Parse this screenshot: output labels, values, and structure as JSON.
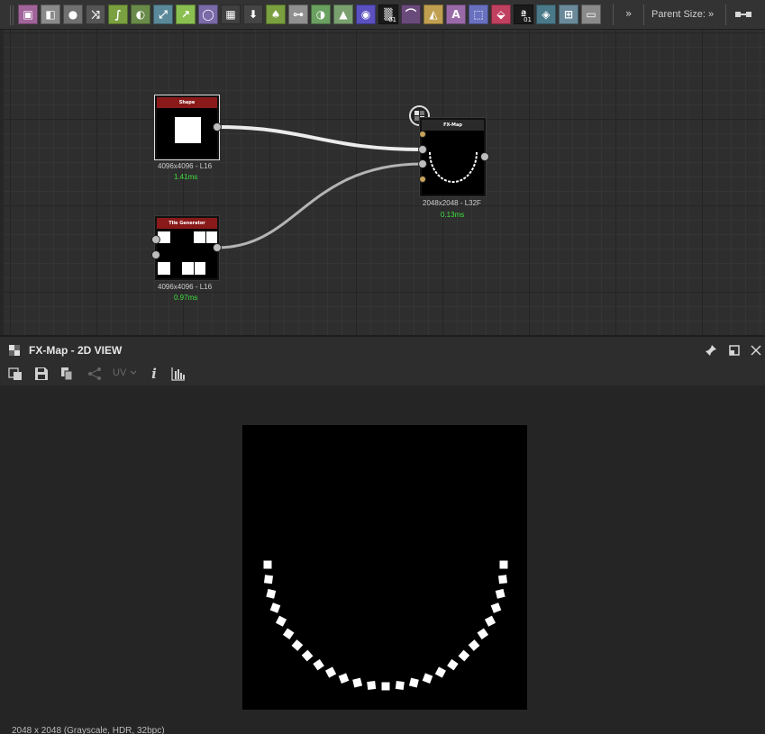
{
  "toolbar": {
    "icons": [
      {
        "name": "bitmap-icon",
        "color": "#a0649a",
        "glyph": "▣"
      },
      {
        "name": "svg-icon",
        "color": "#8a8a8a",
        "glyph": "◧"
      },
      {
        "name": "uniform-color-icon",
        "color": "#707070",
        "glyph": "●"
      },
      {
        "name": "random-icon",
        "color": "#555555",
        "glyph": "⤨"
      },
      {
        "name": "curve-icon",
        "color": "#7aa040",
        "glyph": "∫"
      },
      {
        "name": "gradient-map-icon",
        "color": "#6a8a4a",
        "glyph": "◐"
      },
      {
        "name": "transform-icon",
        "color": "#5a8a9a",
        "glyph": "⤢"
      },
      {
        "name": "directional-warp-icon",
        "color": "#8ac050",
        "glyph": "↗"
      },
      {
        "name": "shape-icon",
        "color": "#7a6aa8",
        "glyph": "◯"
      },
      {
        "name": "tile-icon",
        "color": "#404040",
        "glyph": "▦"
      },
      {
        "name": "output-icon",
        "color": "#454545",
        "glyph": "⬇"
      },
      {
        "name": "blend-icon",
        "color": "#7aa040",
        "glyph": "♠"
      },
      {
        "name": "switch-icon",
        "color": "#909090",
        "glyph": "⊶"
      },
      {
        "name": "levels-icon",
        "color": "#6aa060",
        "glyph": "◑"
      },
      {
        "name": "histogram-icon",
        "color": "#7aa070",
        "glyph": "▲"
      },
      {
        "name": "hsl-icon",
        "color": "#5a50c0",
        "glyph": "◉"
      },
      {
        "name": "noise-icon",
        "color": "#1a1a1a",
        "glyph": "▒",
        "sub": "01"
      },
      {
        "name": "warp-icon",
        "color": "#6a4a7a",
        "glyph": "⌒"
      },
      {
        "name": "sharpen-icon",
        "color": "#c0a050",
        "glyph": "◭"
      },
      {
        "name": "text-icon",
        "color": "#9a6aa8",
        "glyph": "A"
      },
      {
        "name": "crop-icon",
        "color": "#6a70c0",
        "glyph": "⬚"
      },
      {
        "name": "fill-icon",
        "color": "#c04060",
        "glyph": "⬙"
      },
      {
        "name": "pixel-processor-icon",
        "color": "#1a1a1a",
        "glyph": "ª",
        "sub": "01"
      },
      {
        "name": "distance-icon",
        "color": "#4a7a8a",
        "glyph": "◈"
      },
      {
        "name": "fxmap-icon",
        "color": "#6a8a9a",
        "glyph": "⊞"
      },
      {
        "name": "graph-instance-icon",
        "color": "#8a8a8a",
        "glyph": "▭"
      }
    ],
    "more_glyph": "»",
    "parent_size_label": "Parent Size: »"
  },
  "graph": {
    "nodes": [
      {
        "title": "Shape",
        "header_color": "#8a1a1a",
        "resolution": "4096x4096 - L16",
        "time": "1.41ms"
      },
      {
        "title": "Tile Generator",
        "header_color": "#8a1a1a",
        "resolution": "4096x4096 - L16",
        "time": "0.97ms"
      },
      {
        "title": "FX-Map",
        "header_color": "#2a2a2a",
        "resolution": "2048x2048 - L32F",
        "time": "0.13ms"
      }
    ]
  },
  "panel": {
    "title": "FX-Map - 2D VIEW",
    "uv_label": "UV",
    "info_glyph": "i",
    "status": "2048 x 2048 (Grayscale, HDR, 32bpc)"
  },
  "colors": {
    "wire_main": "#ececec",
    "wire_secondary": "#b4b4b4",
    "time_green": "#3ee03e"
  }
}
